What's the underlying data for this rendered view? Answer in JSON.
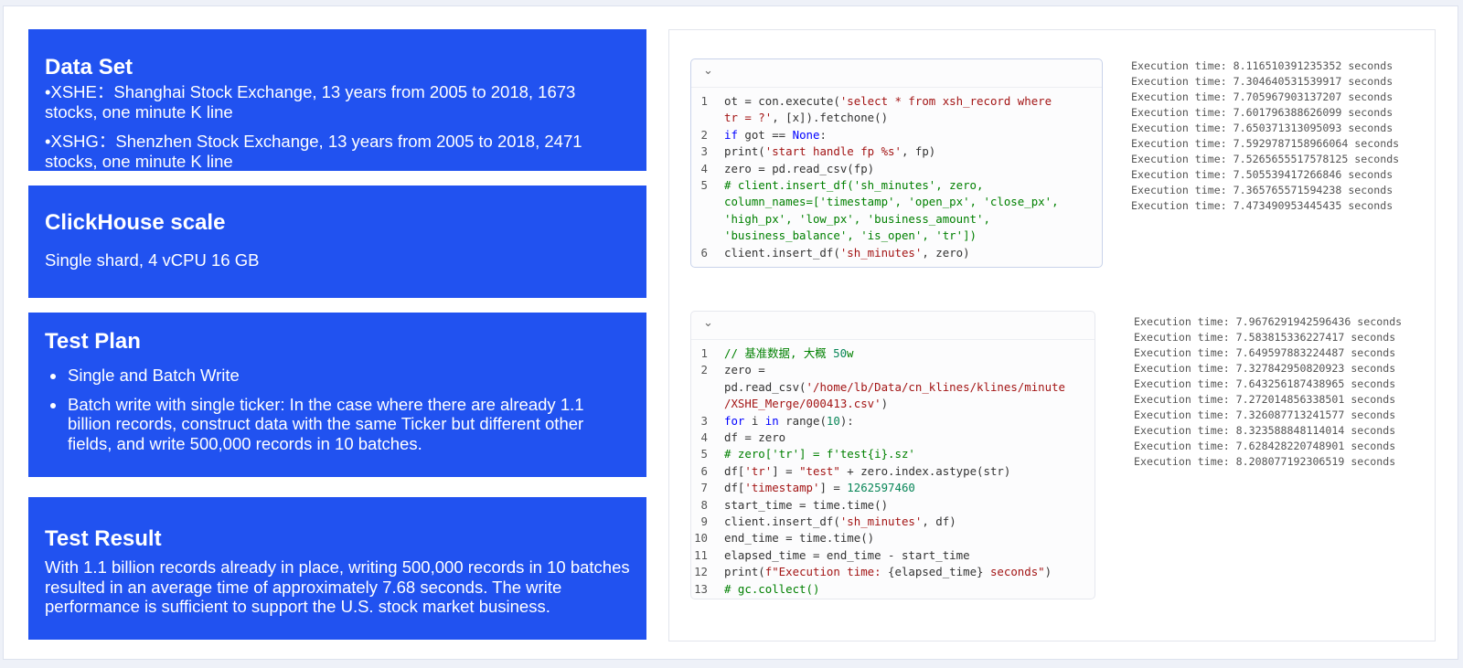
{
  "panels": {
    "dataset": {
      "title": "Data Set",
      "line1": "•XSHE：Shanghai Stock Exchange, 13 years from 2005 to 2018, 1673 stocks, one minute K line",
      "line2": "•XSHG：Shenzhen Stock Exchange, 13 years from 2005 to 2018, 2471 stocks, one minute K line"
    },
    "scale": {
      "title": "ClickHouse scale",
      "body": "Single shard, 4 vCPU 16 GB"
    },
    "plan": {
      "title": "Test Plan",
      "items": [
        "Single and Batch Write",
        "Batch write with single ticker:   In the case where there are already 1.1 billion records, construct data with the same Ticker but different other fields, and write 500,000 records in 10 batches."
      ]
    },
    "result": {
      "title": "Test Result",
      "body": "With 1.1 billion records already in place, writing 500,000 records in 10 batches resulted in an average time of approximately 7.68 seconds. The write performance is sufficient to support the U.S. stock market business."
    }
  },
  "cell1": {
    "chevron": "⌄",
    "line_numbers": [
      "1",
      "",
      "2",
      "3",
      "4",
      "5",
      "",
      "",
      "",
      "6"
    ],
    "output": [
      "Execution time: 8.116510391235352 seconds",
      "Execution time: 7.304640531539917 seconds",
      "Execution time: 7.705967903137207 seconds",
      "Execution time: 7.601796388626099 seconds",
      "Execution time: 7.650371313095093 seconds",
      "Execution time: 7.5929787158966064 seconds",
      "Execution time: 7.5265655517578125 seconds",
      "Execution time: 7.505539417266846 seconds",
      "Execution time: 7.365765571594238 seconds",
      "Execution time: 7.473490953445435 seconds"
    ]
  },
  "cell2": {
    "chevron": "⌄",
    "line_numbers": [
      "1",
      "2",
      "",
      "",
      "3",
      "4",
      "5",
      "6",
      "7",
      "8",
      "9",
      "10",
      "11",
      "12",
      "13"
    ],
    "output": [
      "Execution time: 7.9676291942596436 seconds",
      "Execution time: 7.583815336227417 seconds",
      "Execution time: 7.649597883224487 seconds",
      "Execution time: 7.327842950820923 seconds",
      "Execution time: 7.643256187438965 seconds",
      "Execution time: 7.272014856338501 seconds",
      "Execution time: 7.326087713241577 seconds",
      "Execution time: 8.323588848114014 seconds",
      "Execution time: 7.628428220748901 seconds",
      "Execution time: 8.208077192306519 seconds"
    ]
  },
  "code1": [
    [
      [
        "t",
        "ot = con.execute("
      ],
      [
        "s",
        "'select * from xsh_record where"
      ]
    ],
    [
      [
        "s",
        "tr = ?'"
      ],
      [
        "t",
        ", [x]).fetchone()"
      ]
    ],
    [
      [
        "k",
        "if"
      ],
      [
        "t",
        " got == "
      ],
      [
        "k",
        "None"
      ],
      [
        "t",
        ":"
      ]
    ],
    [
      [
        "t",
        "print("
      ],
      [
        "s",
        "'start handle fp %s'"
      ],
      [
        "t",
        ", fp)"
      ]
    ],
    [
      [
        "t",
        "zero = pd.read_csv(fp)"
      ]
    ],
    [
      [
        "c",
        "# client.insert_df('sh_minutes', zero,"
      ]
    ],
    [
      [
        "c",
        "column_names=['timestamp', 'open_px', 'close_px',"
      ]
    ],
    [
      [
        "c",
        "'high_px', 'low_px', 'business_amount',"
      ]
    ],
    [
      [
        "c",
        "'business_balance', 'is_open', 'tr'])"
      ]
    ],
    [
      [
        "t",
        "client.insert_df("
      ],
      [
        "s",
        "'sh_minutes'"
      ],
      [
        "t",
        ", zero)"
      ]
    ]
  ],
  "code2": [
    [
      [
        "c",
        "// 基准数据, 大概 "
      ],
      [
        "n",
        "50"
      ],
      [
        "c",
        "w"
      ]
    ],
    [
      [
        "t",
        "zero ="
      ]
    ],
    [
      [
        "t",
        "pd.read_csv("
      ],
      [
        "s",
        "'/home/lb/Data/cn_klines/klines/minute"
      ]
    ],
    [
      [
        "s",
        "/XSHE_Merge/000413.csv'"
      ],
      [
        "t",
        ")"
      ]
    ],
    [
      [
        "k",
        "for"
      ],
      [
        "t",
        " i "
      ],
      [
        "k",
        "in"
      ],
      [
        "t",
        " range("
      ],
      [
        "n",
        "10"
      ],
      [
        "t",
        "):"
      ]
    ],
    [
      [
        "t",
        "df = zero"
      ]
    ],
    [
      [
        "c",
        "# zero['tr'] = f'test{i}.sz'"
      ]
    ],
    [
      [
        "t",
        "df["
      ],
      [
        "s",
        "'tr'"
      ],
      [
        "t",
        "] = "
      ],
      [
        "s",
        "\"test\""
      ],
      [
        "t",
        " + zero.index.astype(str)"
      ]
    ],
    [
      [
        "t",
        "df["
      ],
      [
        "s",
        "'timestamp'"
      ],
      [
        "t",
        "] = "
      ],
      [
        "n",
        "1262597460"
      ]
    ],
    [
      [
        "t",
        "start_time = time.time()"
      ]
    ],
    [
      [
        "t",
        "client.insert_df("
      ],
      [
        "s",
        "'sh_minutes'"
      ],
      [
        "t",
        ", df)"
      ]
    ],
    [
      [
        "t",
        "end_time = time.time()"
      ]
    ],
    [
      [
        "t",
        "elapsed_time = end_time - start_time"
      ]
    ],
    [
      [
        "t",
        "print("
      ],
      [
        "s",
        "f\"Execution time: "
      ],
      [
        "t",
        "{elapsed_time}"
      ],
      [
        "s",
        " seconds\""
      ],
      [
        "t",
        ")"
      ]
    ],
    [
      [
        "c",
        "# gc.collect()"
      ]
    ]
  ]
}
